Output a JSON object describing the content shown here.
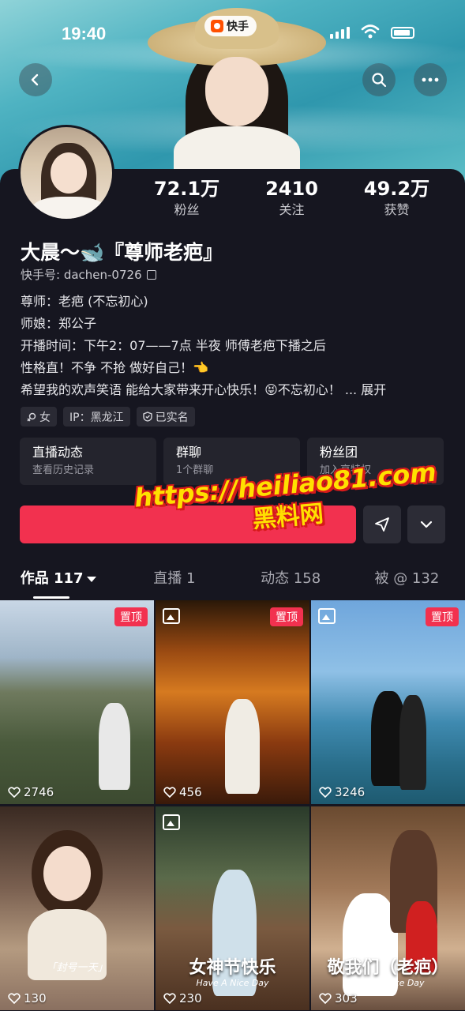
{
  "status_bar": {
    "time": "19:40",
    "brand": "快手"
  },
  "profile": {
    "name": "大晨～🐋『尊师老疤』",
    "uid_label": "快手号: dachen-0726",
    "stats": [
      {
        "num": "72.1万",
        "label": "粉丝"
      },
      {
        "num": "2410",
        "label": "关注"
      },
      {
        "num": "49.2万",
        "label": "获赞"
      }
    ],
    "bio": [
      "尊师：老疤 (不忘初心)",
      "师娘：郑公子",
      "开播时间：下午2：07——7点  半夜 师傅老疤下播之后",
      "性格直！不争 不抢  做好自己！👈",
      "希望我的欢声笑语 能给大家带来开心快乐！😝不忘初心！ ..."
    ],
    "expand_label": "展开",
    "tags": [
      {
        "icon": "female-icon",
        "label": "女"
      },
      {
        "icon": "",
        "label": "IP：黑龙江"
      },
      {
        "icon": "verified-shield-icon",
        "label": "已实名"
      }
    ]
  },
  "cards": [
    {
      "title": "直播动态",
      "sub": "查看历史记录"
    },
    {
      "title": "群聊",
      "sub": "1个群聊"
    },
    {
      "title": "粉丝团",
      "sub": "加入享特权"
    }
  ],
  "follow_label": "",
  "watermark": {
    "url": "https://heiliao81.com",
    "cn": "黑料网"
  },
  "tabs": [
    {
      "label": "作品 117"
    },
    {
      "label": "直播 1"
    },
    {
      "label": "动态 158"
    },
    {
      "label": "被 @ 132"
    }
  ],
  "grid": [
    {
      "likes": "2746",
      "pin": "置顶",
      "caption": "",
      "sub": "",
      "small": ""
    },
    {
      "likes": "456",
      "pin": "置顶",
      "caption": "",
      "sub": "",
      "small": ""
    },
    {
      "likes": "3246",
      "pin": "置顶",
      "caption": "",
      "sub": "",
      "small": ""
    },
    {
      "likes": "130",
      "pin": "",
      "caption": "",
      "sub": "",
      "small": "「封号一天」"
    },
    {
      "likes": "230",
      "pin": "",
      "caption": "女神节快乐",
      "sub": "Have A Nice Day",
      "small": ""
    },
    {
      "likes": "303",
      "pin": "",
      "caption": "敬我们（老疤）",
      "sub": "Have A Nice Day",
      "small": ""
    }
  ]
}
